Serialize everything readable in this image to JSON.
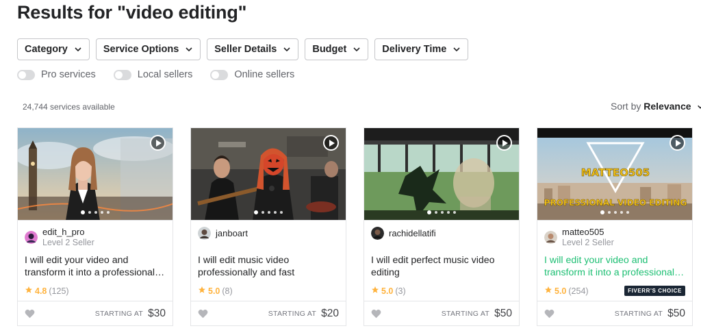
{
  "page": {
    "title": "Results for \"video editing\""
  },
  "filters": [
    {
      "label": "Category",
      "icon": "chevron-down-icon"
    },
    {
      "label": "Service Options",
      "icon": "chevron-down-icon"
    },
    {
      "label": "Seller Details",
      "icon": "chevron-down-icon"
    },
    {
      "label": "Budget",
      "icon": "chevron-down-icon"
    },
    {
      "label": "Delivery Time",
      "icon": "chevron-down-icon"
    }
  ],
  "toggles": [
    {
      "label": "Pro services",
      "on": false
    },
    {
      "label": "Local sellers",
      "on": false
    },
    {
      "label": "Online sellers",
      "on": false
    }
  ],
  "results": {
    "count": "24,744 services available",
    "sort_prefix": "Sort by",
    "sort_value": "Relevance"
  },
  "colors": {
    "accent_green": "#1dbf73",
    "star": "#ffb33e",
    "badge_bg": "#1a2634"
  },
  "cards": [
    {
      "seller": "edit_h_pro",
      "level": "Level 2 Seller",
      "title": "I will edit your video and transform it into a professional…",
      "rating": "4.8",
      "reviews": "(125)",
      "starting": "STARTING AT",
      "price": "$30",
      "badge": "",
      "choice": false,
      "thumb_overlay": ""
    },
    {
      "seller": "janboart",
      "level": "",
      "title": "I will edit music video professionally and fast",
      "rating": "5.0",
      "reviews": "(8)",
      "starting": "STARTING AT",
      "price": "$20",
      "badge": "",
      "choice": false,
      "thumb_overlay": ""
    },
    {
      "seller": "rachidellatifi",
      "level": "",
      "title": "I will edit perfect music video editing",
      "rating": "5.0",
      "reviews": "(3)",
      "starting": "STARTING AT",
      "price": "$50",
      "badge": "",
      "choice": false,
      "thumb_overlay": ""
    },
    {
      "seller": "matteo505",
      "level": "Level 2 Seller",
      "title": "I will edit your video and transform it into a professional…",
      "rating": "5.0",
      "reviews": "(254)",
      "starting": "STARTING AT",
      "price": "$50",
      "badge": "FIVERR'S CHOICE",
      "choice": true,
      "thumb_overlay": "MATTEO505",
      "thumb_overlay2": "PROFESSIONAL VIDEO EDITING"
    }
  ]
}
